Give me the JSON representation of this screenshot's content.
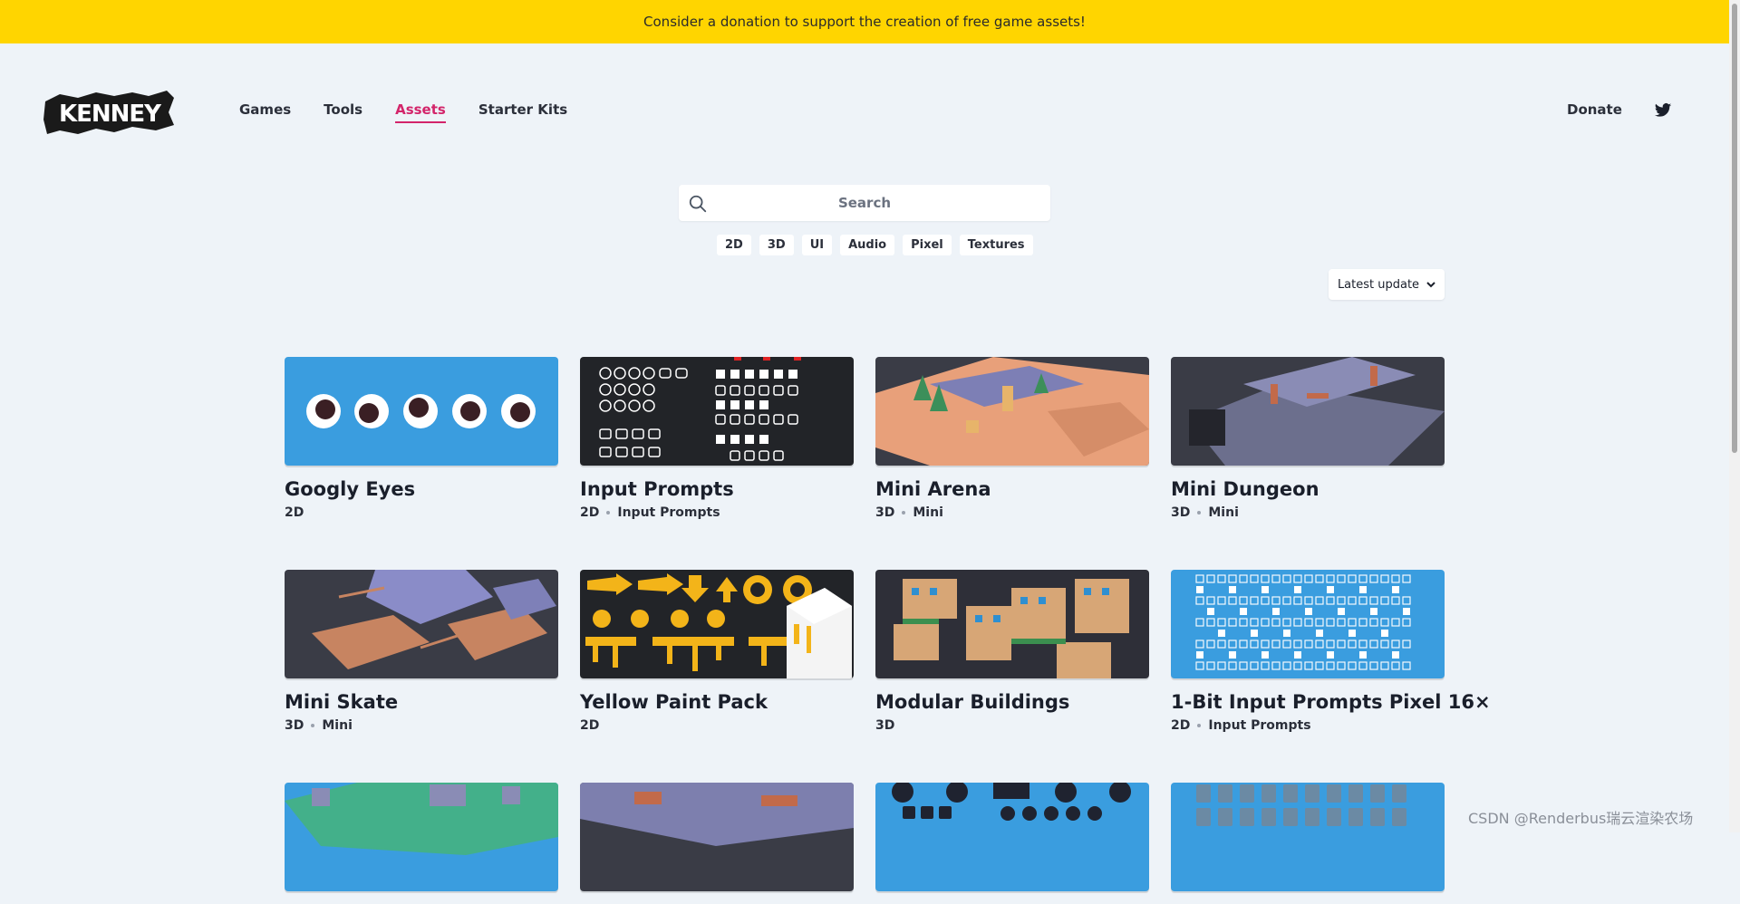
{
  "banner": {
    "text": "Consider a donation to support the creation of free game assets!"
  },
  "brand": {
    "logo_text": "KENNEY"
  },
  "nav": {
    "items": [
      {
        "label": "Games",
        "active": false
      },
      {
        "label": "Tools",
        "active": false
      },
      {
        "label": "Assets",
        "active": true
      },
      {
        "label": "Starter Kits",
        "active": false
      }
    ],
    "donate_label": "Donate",
    "twitter_icon": "twitter-icon"
  },
  "search": {
    "placeholder": "Search",
    "icon": "search-icon"
  },
  "filters": [
    "2D",
    "3D",
    "UI",
    "Audio",
    "Pixel",
    "Textures"
  ],
  "sort": {
    "selected": "Latest update",
    "icon": "chevron-down-icon"
  },
  "assets": [
    {
      "title": "Googly Eyes",
      "tags": [
        "2D"
      ]
    },
    {
      "title": "Input Prompts",
      "tags": [
        "2D",
        "Input Prompts"
      ]
    },
    {
      "title": "Mini Arena",
      "tags": [
        "3D",
        "Mini"
      ]
    },
    {
      "title": "Mini Dungeon",
      "tags": [
        "3D",
        "Mini"
      ]
    },
    {
      "title": "Mini Skate",
      "tags": [
        "3D",
        "Mini"
      ]
    },
    {
      "title": "Yellow Paint Pack",
      "tags": [
        "2D"
      ]
    },
    {
      "title": "Modular Buildings",
      "tags": [
        "3D"
      ]
    },
    {
      "title": "1-Bit Input Prompts Pixel 16×",
      "tags": [
        "2D",
        "Input Prompts"
      ]
    },
    {
      "title": "",
      "tags": []
    },
    {
      "title": "",
      "tags": []
    },
    {
      "title": "",
      "tags": []
    },
    {
      "title": "",
      "tags": []
    }
  ],
  "watermark": "CSDN @Renderbus瑞云渲染农场",
  "colors": {
    "banner": "#ffd500",
    "accent": "#d3246a",
    "background": "#eef3f8"
  }
}
